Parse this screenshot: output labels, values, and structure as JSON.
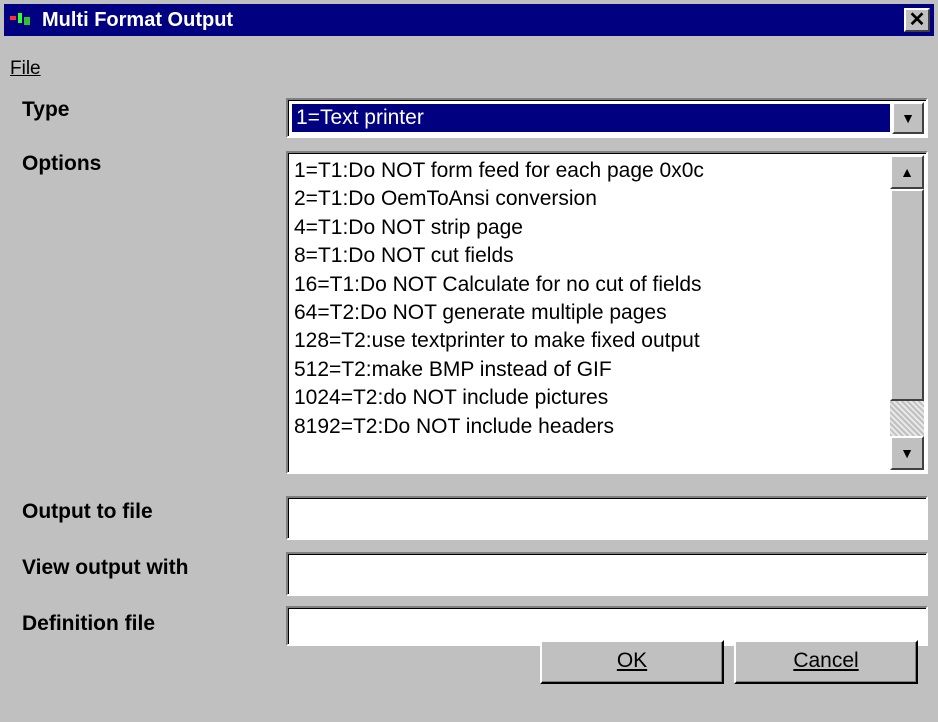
{
  "window": {
    "title": "Multi Format Output",
    "close_glyph": "✕"
  },
  "menu": {
    "file_label": "File"
  },
  "labels": {
    "type": "Type",
    "options": "Options",
    "output_to_file": "Output to file",
    "view_output_with": "View output with",
    "definition_file": "Definition file"
  },
  "type_select": {
    "selected": "1=Text printer"
  },
  "options": [
    "1=T1:Do NOT form feed for each page 0x0c",
    "2=T1:Do OemToAnsi conversion",
    "4=T1:Do NOT strip page",
    "8=T1:Do NOT cut fields",
    "16=T1:Do NOT Calculate for no cut of fields",
    "64=T2:Do NOT generate multiple pages",
    "128=T2:use textprinter to make fixed output",
    "512=T2:make BMP instead of GIF",
    "1024=T2:do NOT include pictures",
    "8192=T2:Do NOT include headers"
  ],
  "fields": {
    "output_to_file": "",
    "view_output_with": "",
    "definition_file": ""
  },
  "buttons": {
    "ok": "OK",
    "cancel": "Cancel"
  },
  "icons": {
    "app": "app-icon",
    "close": "close-icon",
    "dropdown": "chevron-down-icon",
    "scroll_up": "scroll-up-icon",
    "scroll_down": "scroll-down-icon"
  },
  "colors": {
    "titlebar": "#000080",
    "face": "#c0c0c0",
    "selection": "#000080"
  }
}
